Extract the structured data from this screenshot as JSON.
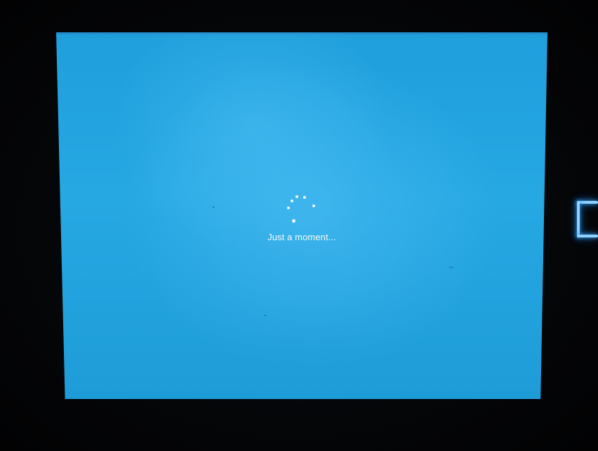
{
  "screen": {
    "message": "Just a moment...",
    "background_color": "#23a3de",
    "text_color": "#f3faff"
  },
  "spinner": {
    "icon": "loading-spinner-icon",
    "dot_count": 6
  },
  "power_indicator": {
    "icon": "power-led-icon",
    "color": "#8fd2ff"
  }
}
